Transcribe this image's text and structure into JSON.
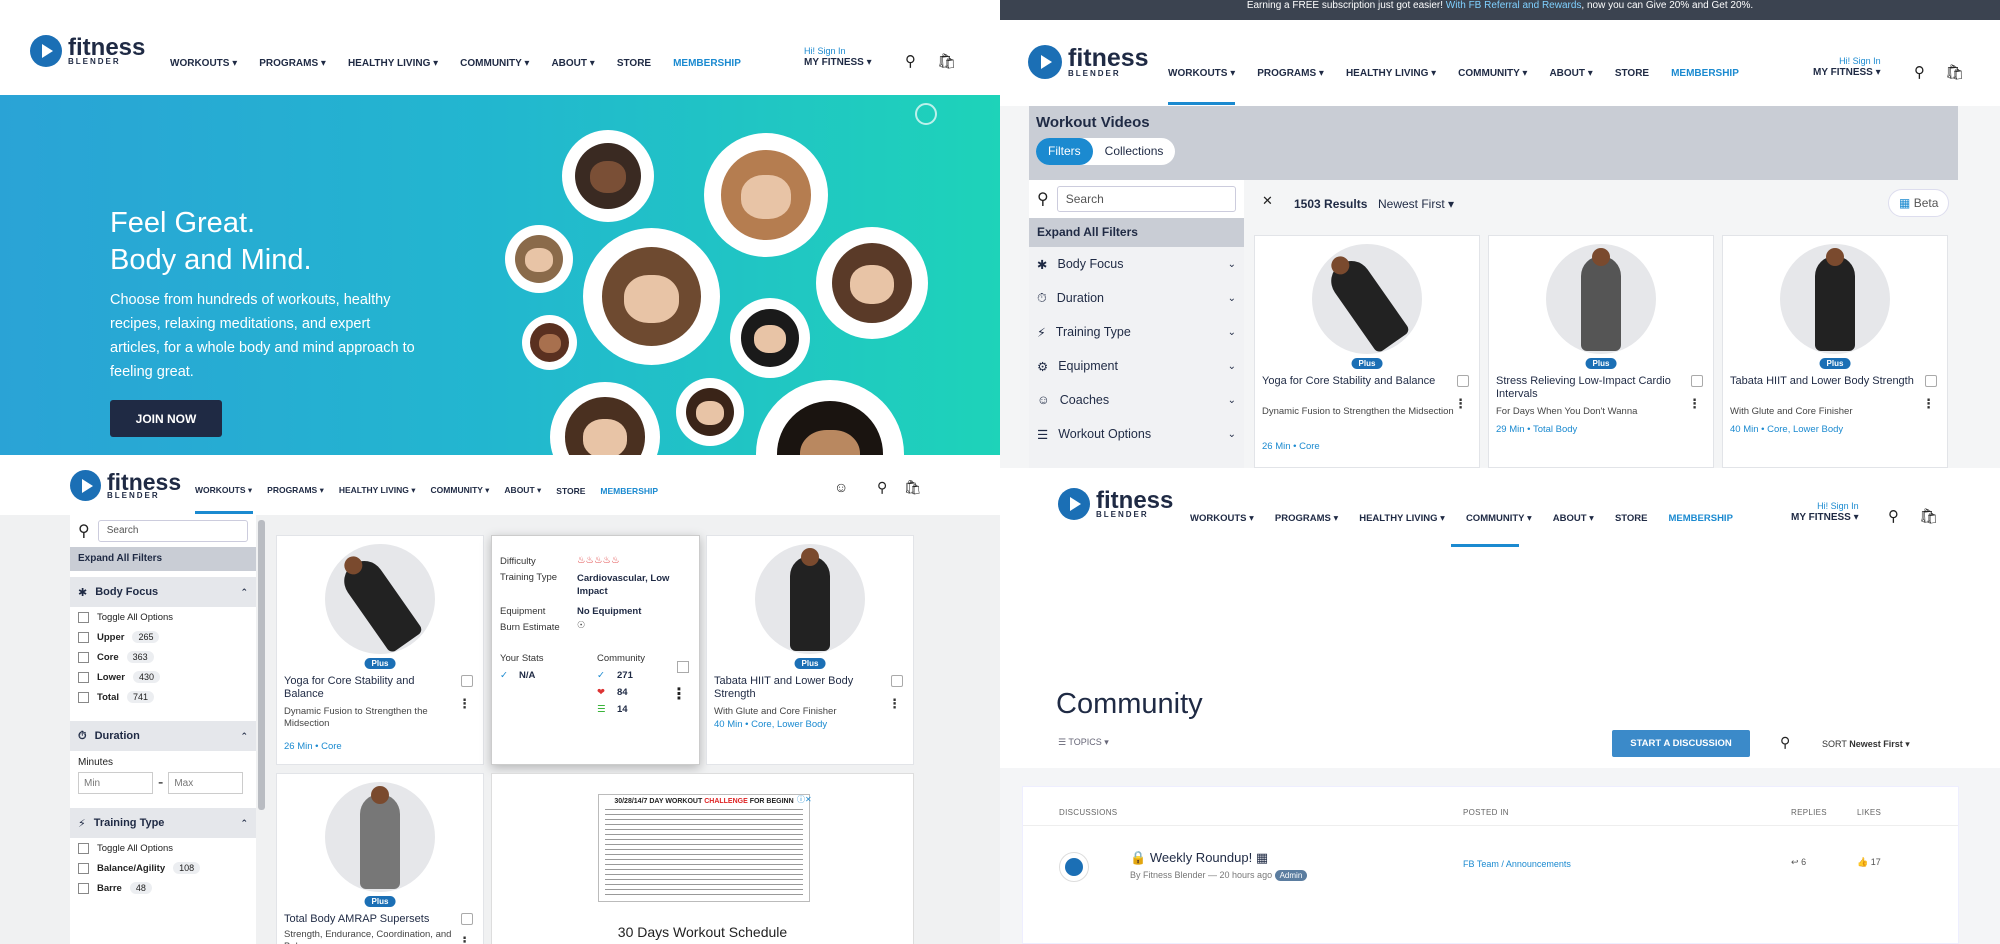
{
  "nav": {
    "workouts": "WORKOUTS ▾",
    "programs": "PROGRAMS ▾",
    "healthy_living": "HEALTHY LIVING ▾",
    "community": "COMMUNITY ▾",
    "about": "ABOUT ▾",
    "store": "STORE",
    "membership": "MEMBERSHIP"
  },
  "brand": {
    "name": "fitness",
    "sub": "BLENDER"
  },
  "account": {
    "signin": "Hi! Sign In",
    "my": "MY FITNESS ▾"
  },
  "hero": {
    "title1": "Feel Great.",
    "title2": "Body and Mind.",
    "body": "Choose from hundreds of workouts, healthy recipes, relaxing meditations, and expert articles, for a whole body and mind approach to feeling great.",
    "cta": "JOIN NOW"
  },
  "banner": {
    "pre": "Earning a FREE subscription just got easier! ",
    "link": "With FB Referral and Rewards",
    "post": ", now you can Give 20% and Get 20%."
  },
  "videos": {
    "title": "Workout Videos",
    "filters": "Filters",
    "collections": "Collections",
    "search_placeholder": "Search",
    "expand": "Expand All Filters",
    "results": "1503 Results",
    "sort": "Newest First ▾",
    "beta": "Beta",
    "filter_rows": [
      "Body Focus",
      "Duration",
      "Training Type",
      "Equipment",
      "Coaches",
      "Workout Options"
    ]
  },
  "cards": [
    {
      "title": "Yoga for Core Stability and Balance",
      "sub": "Dynamic Fusion to Strengthen the Midsection",
      "meta": "26 Min • Core",
      "badge": "Plus"
    },
    {
      "title": "Stress Relieving Low-Impact Cardio Intervals",
      "sub": "For Days When You Don't Wanna",
      "meta": "29 Min • Total Body",
      "badge": "Plus"
    },
    {
      "title": "Tabata HIIT and Lower Body Strength",
      "sub": "With Glute and Core Finisher",
      "meta": "40 Min • Core, Lower Body",
      "badge": "Plus"
    },
    {
      "title": "Total Body AMRAP Supersets",
      "sub": "Strength, Endurance, Coordination, and Balance",
      "badge": "Plus"
    }
  ],
  "filters3": {
    "body_focus": "Body Focus",
    "toggle": "Toggle All Options",
    "options": [
      {
        "label": "Upper",
        "n": "265"
      },
      {
        "label": "Core",
        "n": "363"
      },
      {
        "label": "Lower",
        "n": "430"
      },
      {
        "label": "Total",
        "n": "741"
      }
    ],
    "duration": "Duration",
    "minutes": "Minutes",
    "min": "Min",
    "max": "Max",
    "training": "Training Type",
    "tt_options": [
      {
        "label": "Balance/Agility",
        "n": "108"
      },
      {
        "label": "Barre",
        "n": "48"
      }
    ]
  },
  "popup": {
    "difficulty": "Difficulty",
    "training_type": "Training Type",
    "training_val": "Cardiovascular, Low Impact",
    "equipment": "Equipment",
    "equipment_val": "No Equipment",
    "burn": "Burn Estimate",
    "your_stats": "Your Stats",
    "na": "N/A",
    "community": "Community",
    "c1": "271",
    "c2": "84",
    "c3": "14"
  },
  "ad": {
    "title_pre": "30/28/14/7 DAY WORKOUT ",
    "title_hl": "CHALLENGE",
    "title_post": " FOR BEGINN",
    "caption": "30 Days Workout Schedule"
  },
  "community": {
    "title": "Community",
    "topics": "TOPICS ▾",
    "start": "START A DISCUSSION",
    "sort_label": "SORT",
    "sort_val": "Newest First ▾",
    "cols": [
      "DISCUSSIONS",
      "POSTED IN",
      "REPLIES",
      "LIKES"
    ],
    "post_title": "Weekly Roundup!",
    "post_by": "By Fitness Blender — 20 hours ago",
    "post_badge": "Admin",
    "posted_in": "FB Team / Announcements",
    "replies": "6",
    "likes": "17"
  },
  "colors": {
    "primary": "#1b6fb5",
    "accent": "#1b8ad0",
    "navy": "#1f2a44"
  }
}
